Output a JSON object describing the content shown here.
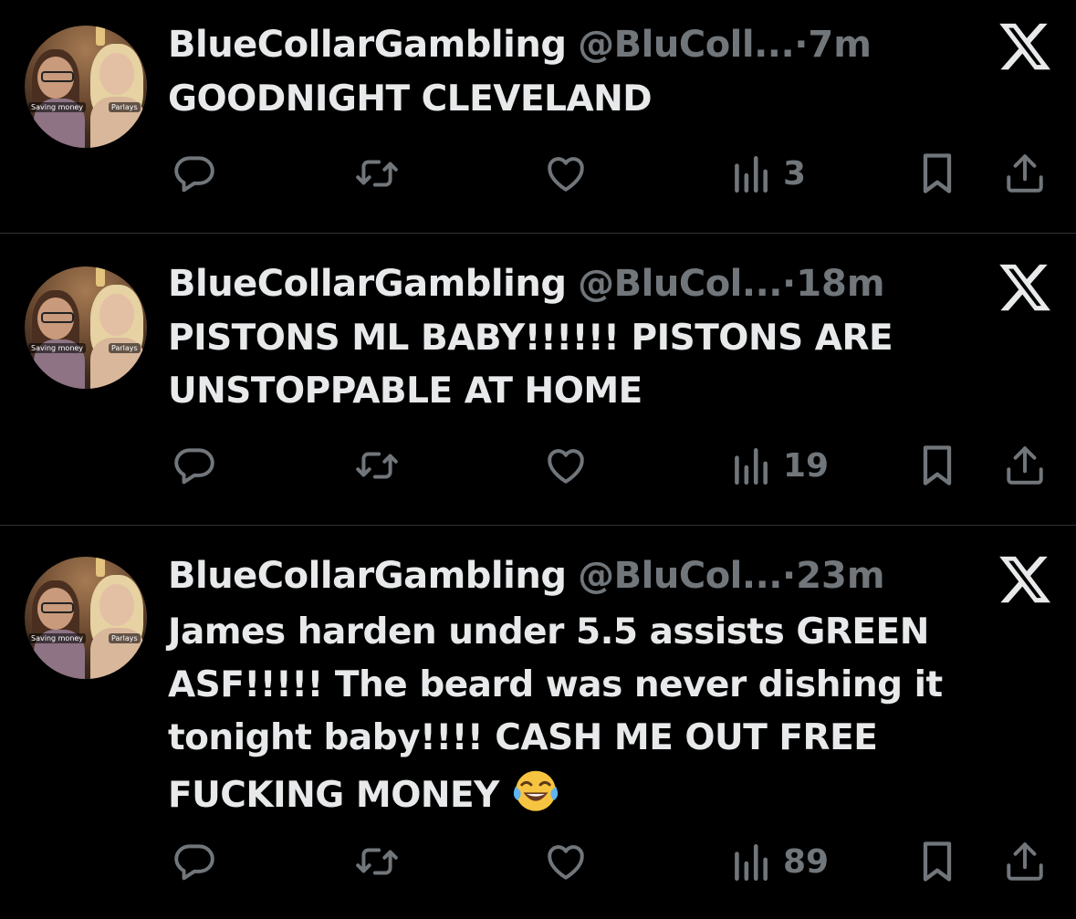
{
  "tweets": [
    {
      "display_name": "BlueCollarGambling",
      "handle": "@BluColl...",
      "separator": "·",
      "time": "7m",
      "text": "GOODNIGHT CLEVELAND",
      "views": "3",
      "avatar_captions": [
        "Saving money",
        "Parlays"
      ]
    },
    {
      "display_name": "BlueCollarGambling",
      "handle": "@BluCol...",
      "separator": "·",
      "time": "18m",
      "text": "PISTONS ML BABY!!!!!! PISTONS ARE UNSTOPPABLE AT HOME",
      "views": "19",
      "avatar_captions": [
        "Saving money",
        "Parlays"
      ]
    },
    {
      "display_name": "BlueCollarGambling",
      "handle": "@BluCol...",
      "separator": "·",
      "time": "23m",
      "text": "James harden under 5.5 assists GREEN ASF!!!!! The beard was never dishing it tonight baby!!!! CASH ME OUT FREE FUCKING MONEY",
      "emoji": "face-with-tears-of-joy",
      "views": "89",
      "avatar_captions": [
        "Saving money",
        "Parlays"
      ]
    }
  ],
  "icons": {
    "platform": "x-logo-icon",
    "reply": "reply-icon",
    "repost": "repost-icon",
    "like": "like-icon",
    "views": "views-icon",
    "bookmark": "bookmark-icon",
    "share": "share-icon"
  },
  "colors": {
    "background": "#000000",
    "primary_text": "#e7e9ea",
    "secondary_text": "#71767b",
    "divider": "#2f3336"
  }
}
